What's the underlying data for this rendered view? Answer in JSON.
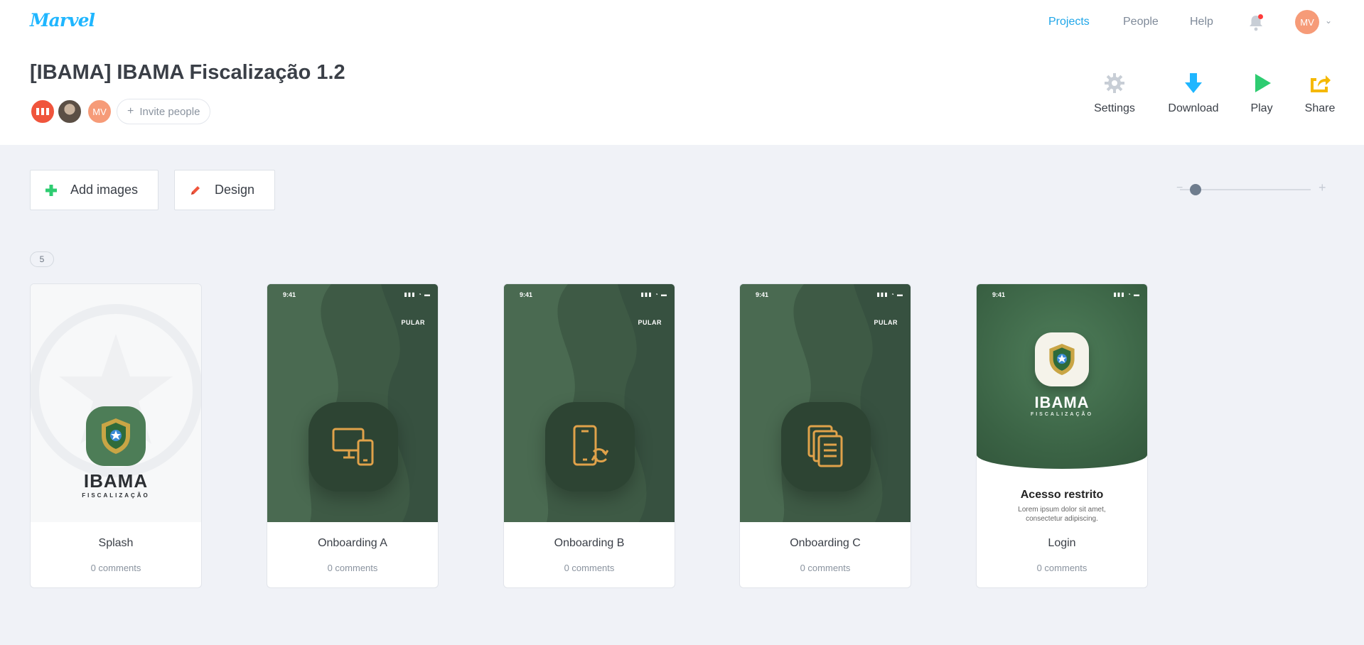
{
  "app": {
    "logo": "Marvel"
  },
  "nav": {
    "items": [
      {
        "label": "Projects",
        "active": true
      },
      {
        "label": "People",
        "active": false
      },
      {
        "label": "Help",
        "active": false
      }
    ],
    "user_initials": "MV"
  },
  "project": {
    "title": "[IBAMA] IBAMA Fiscalização 1.2",
    "members": [
      "MV"
    ],
    "invite_label": "Invite people"
  },
  "actions": {
    "settings": "Settings",
    "download": "Download",
    "play": "Play",
    "share": "Share"
  },
  "toolbar": {
    "add_images": "Add images",
    "design": "Design",
    "zoom_min": "−",
    "zoom_max": "+"
  },
  "screens_count": "5",
  "screens": [
    {
      "name": "Splash",
      "comments": "0 comments",
      "brand": "IBAMA",
      "brand_sub": "FISCALIZAÇÃO"
    },
    {
      "name": "Onboarding A",
      "comments": "0 comments",
      "time": "9:41",
      "skip": "PULAR"
    },
    {
      "name": "Onboarding B",
      "comments": "0 comments",
      "time": "9:41",
      "skip": "PULAR"
    },
    {
      "name": "Onboarding C",
      "comments": "0 comments",
      "time": "9:41",
      "skip": "PULAR"
    },
    {
      "name": "Login",
      "comments": "0 comments",
      "time": "9:41",
      "brand": "IBAMA",
      "brand_sub": "FISCALIZAÇÃO",
      "heading": "Acesso restrito",
      "body": "Lorem ipsum dolor sit amet, consectetur adipiscing."
    }
  ],
  "colors": {
    "accent": "#1fa6e8",
    "add_icon": "#2ecc71",
    "design_icon": "#f0553c",
    "download_icon": "#1fb6ff",
    "play_icon": "#2ecc71",
    "share_icon": "#f5b800",
    "screen_green": "#3e5a45",
    "onboarding_icon": "#e0a24a"
  }
}
